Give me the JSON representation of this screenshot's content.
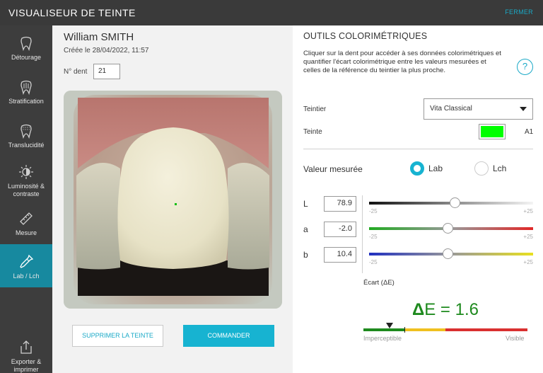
{
  "header": {
    "title": "VISUALISEUR DE TEINTE",
    "close_label": "FERMER"
  },
  "sidebar": {
    "items": [
      {
        "label": "Détourage",
        "icon": "tooth-outline-icon",
        "active": false
      },
      {
        "label": "Stratification",
        "icon": "tooth-layers-icon",
        "active": false
      },
      {
        "label": "Translucidité",
        "icon": "tooth-translucency-icon",
        "active": false
      },
      {
        "label": "Luminosité & contraste",
        "icon": "brightness-icon",
        "active": false
      },
      {
        "label": "Mesure",
        "icon": "ruler-icon",
        "active": false
      },
      {
        "label": "Lab / Lch",
        "icon": "pipette-icon",
        "active": true
      }
    ],
    "export_label": "Exporter & imprimer",
    "export_icon": "export-icon"
  },
  "patient": {
    "name": "William SMITH",
    "created": "Créée le 28/04/2022, 11:57",
    "tooth_label": "N° dent",
    "tooth_number": "21"
  },
  "actions": {
    "delete_label": "SUPPRIMER LA TEINTE",
    "order_label": "COMMANDER"
  },
  "tools": {
    "title": "OUTILS COLORIMÉTRIQUES",
    "description": "Cliquer sur la dent pour accéder à ses données colorimétriques et quantifier l'écart colorimétrique entre les valeurs mesurées et celles de la référence du teintier la plus proche.",
    "help_label": "?",
    "shade_guide_label": "Teintier",
    "shade_guide_value": "Vita Classical",
    "shade_label": "Teinte",
    "shade_color": "#00ff00",
    "shade_name": "A1",
    "measured_label": "Valeur mesurée",
    "modes": [
      {
        "label": "Lab",
        "selected": true
      },
      {
        "label": "Lch",
        "selected": false
      }
    ],
    "channels": [
      {
        "name": "L",
        "value": "78.9",
        "min": "-25",
        "max": "+25",
        "level": 0.52
      },
      {
        "name": "a",
        "value": "-2.0",
        "min": "-25",
        "max": "+25",
        "level": 0.48
      },
      {
        "name": "b",
        "value": "10.4",
        "min": "-25",
        "max": "+25",
        "level": 0.48
      }
    ],
    "delta_label": "Écart (ΔE)",
    "delta_symbol": "Δ",
    "delta_text": "E = 1.6",
    "delta_value": 1.6,
    "scale_low": "Imperceptible",
    "scale_high": "Visible",
    "scale_colors": {
      "green": "#1e8a1e",
      "yellow": "#f0c020",
      "red": "#d93030"
    }
  },
  "colors": {
    "accent": "#17b3d1",
    "sidebar_active": "#17899f",
    "topbar": "#3a3a3a",
    "sidebar": "#3d3d3d"
  }
}
